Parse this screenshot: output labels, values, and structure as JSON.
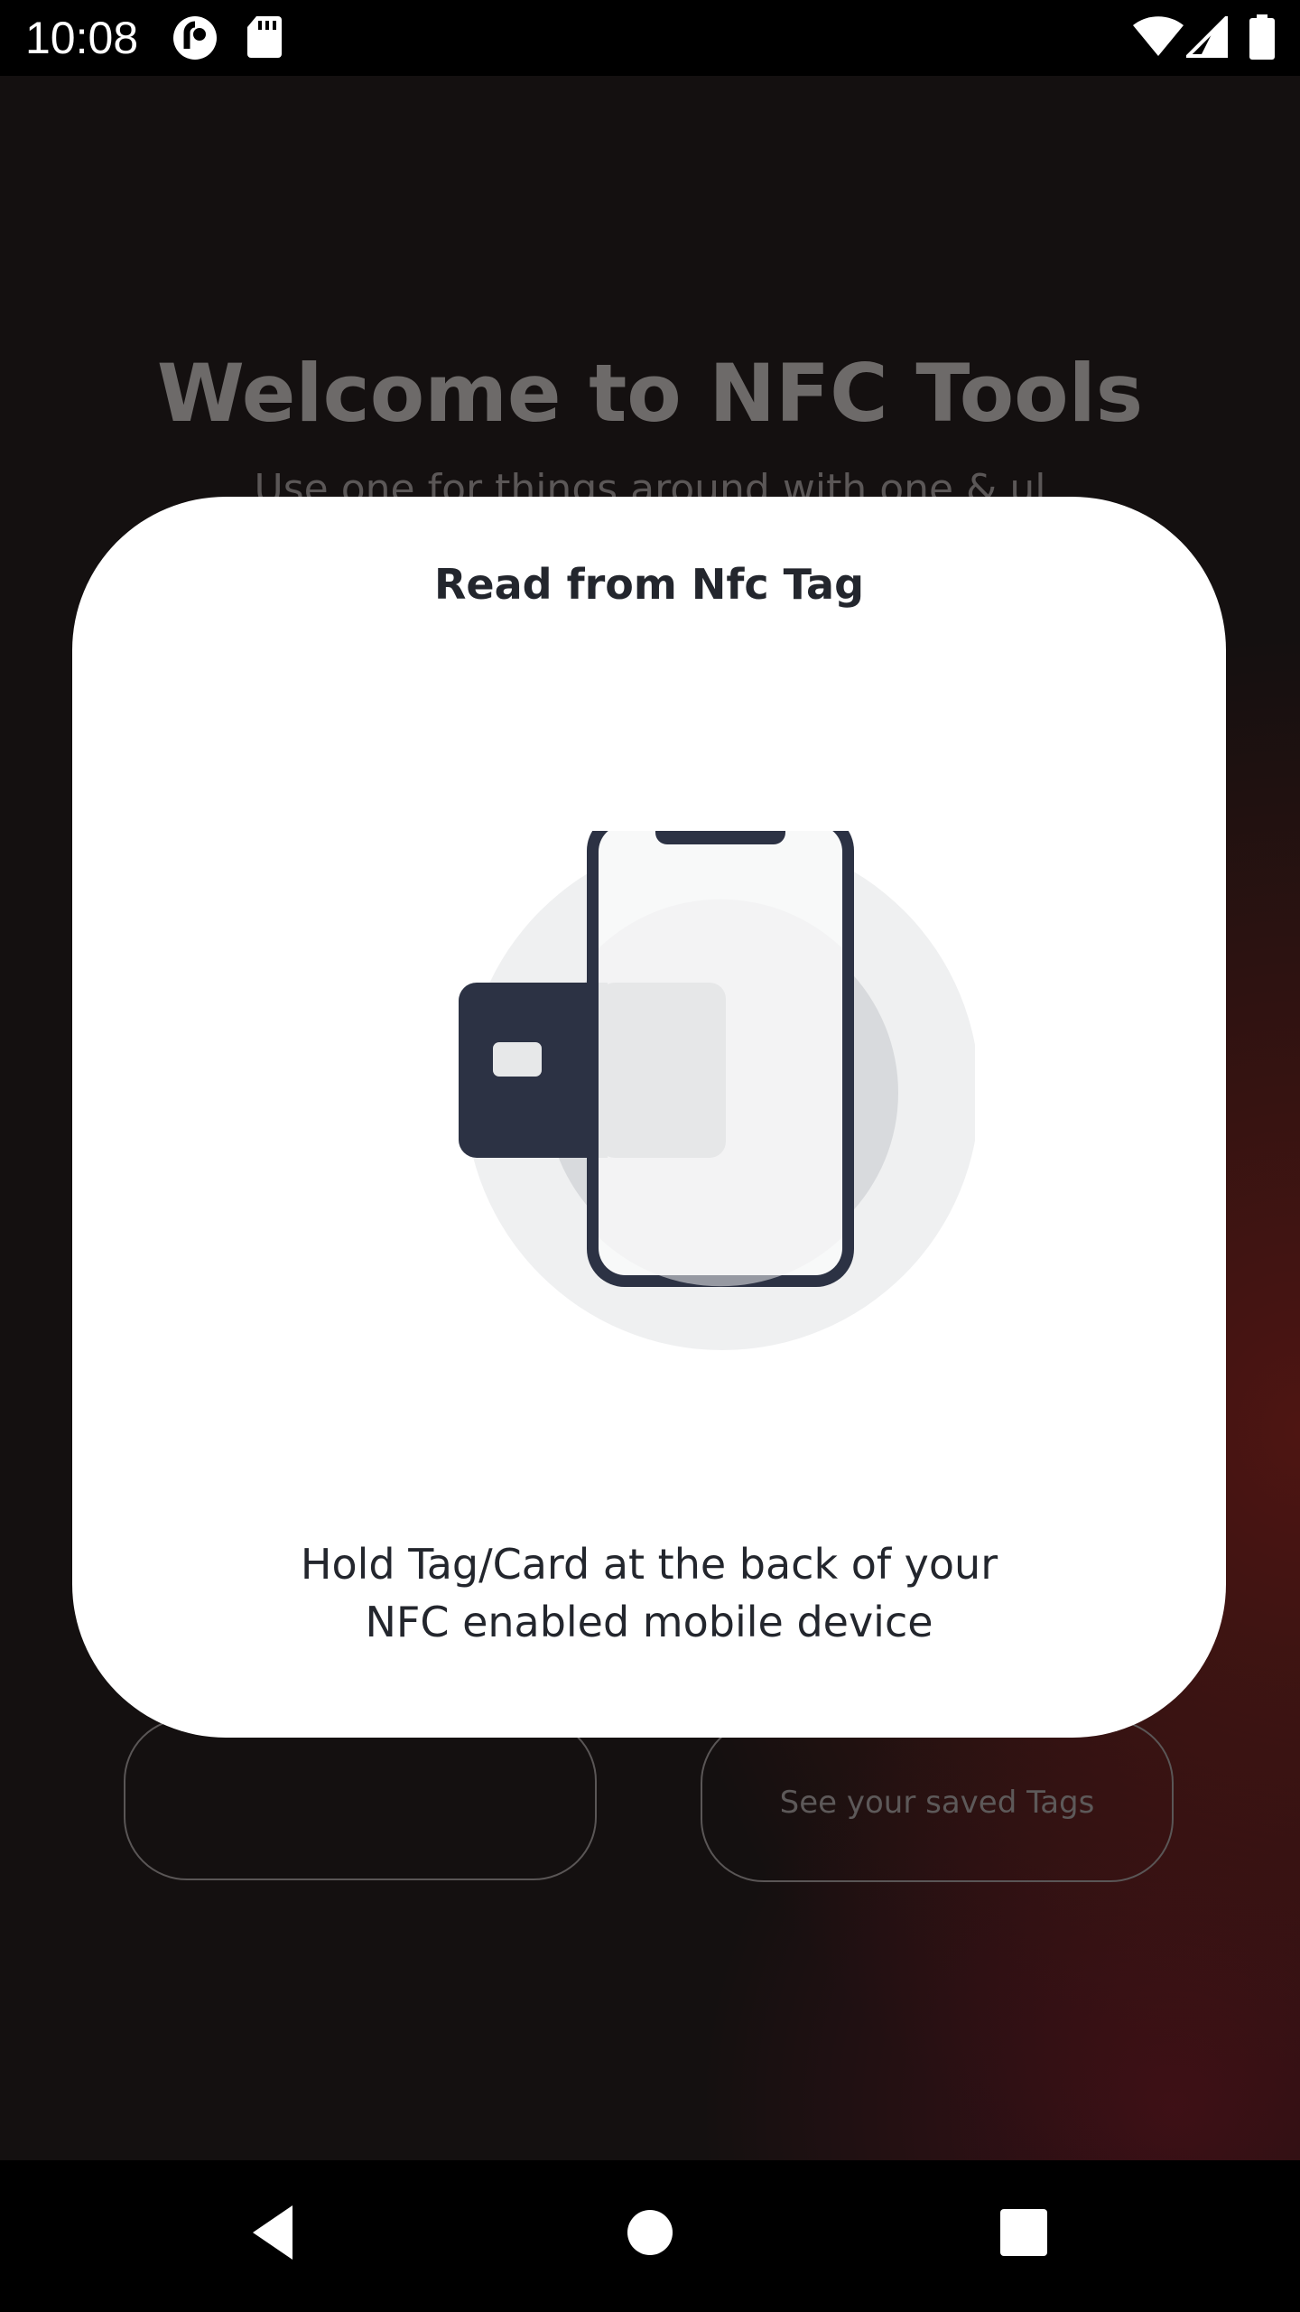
{
  "status_bar": {
    "time": "10:08",
    "icons": [
      "pocket-casts-icon",
      "sd-card-icon",
      "wifi-icon",
      "signal-icon",
      "battery-icon"
    ]
  },
  "background_screen": {
    "title": "Welcome to NFC Tools",
    "subtitle": "Use one for things around with one & ul",
    "cards": [
      {
        "text": ""
      },
      {
        "text": "See your saved Tags"
      }
    ]
  },
  "dialog": {
    "title": "Read from Nfc Tag",
    "illustration": "phone-with-nfc-card-illustration",
    "message_line1": "Hold Tag/Card at the back of your",
    "message_line2": "NFC enabled mobile device"
  },
  "navigation_bar": {
    "buttons": [
      "back",
      "home",
      "recents"
    ]
  },
  "colors": {
    "dialog_background": "#ffffff",
    "text_dark": "#23262d",
    "illustration_navy": "#2c3244",
    "background_dark": "#141010",
    "background_accent": "#4e1512"
  }
}
